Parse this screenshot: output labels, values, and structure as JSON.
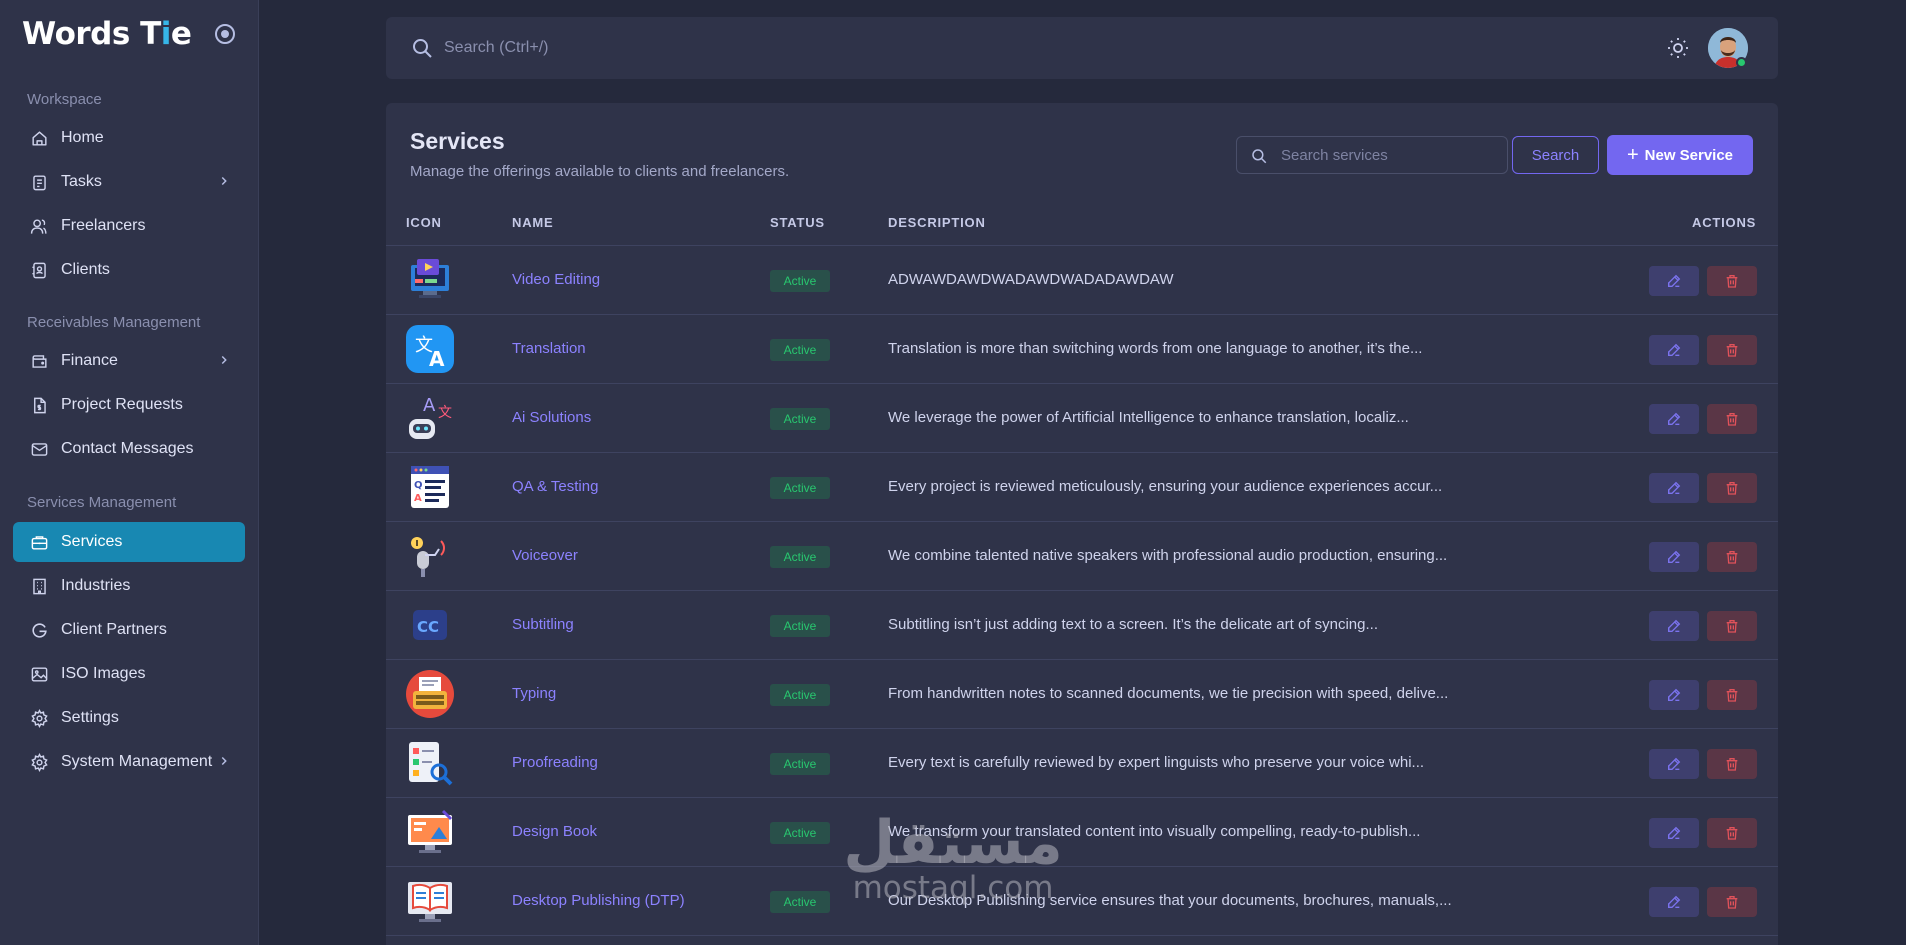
{
  "brand": {
    "name_pre": "Words T",
    "name_accent": "i",
    "name_post": "e"
  },
  "topbar": {
    "search_placeholder": "Search (Ctrl+/)"
  },
  "sidebar": {
    "sections": [
      "Workspace",
      "Receivables Management",
      "Services Management"
    ],
    "items": [
      {
        "label": "Home",
        "icon": "home-icon"
      },
      {
        "label": "Tasks",
        "icon": "clipboard-icon",
        "expandable": true
      },
      {
        "label": "Freelancers",
        "icon": "users-icon"
      },
      {
        "label": "Clients",
        "icon": "address-book-icon"
      },
      {
        "label": "Finance",
        "icon": "wallet-icon",
        "expandable": true
      },
      {
        "label": "Project Requests",
        "icon": "file-dollar-icon"
      },
      {
        "label": "Contact Messages",
        "icon": "mail-icon"
      },
      {
        "label": "Services",
        "icon": "briefcase-icon",
        "active": true
      },
      {
        "label": "Industries",
        "icon": "building-icon"
      },
      {
        "label": "Client Partners",
        "icon": "google-g-icon"
      },
      {
        "label": "ISO Images",
        "icon": "image-icon"
      },
      {
        "label": "Settings",
        "icon": "gear-icon"
      },
      {
        "label": "System Management",
        "icon": "gear-icon",
        "expandable": true
      }
    ]
  },
  "services": {
    "title": "Services",
    "subtitle": "Manage the offerings available to clients and freelancers.",
    "search_placeholder": "Search services",
    "search_button": "Search",
    "new_button": "New Service",
    "columns": [
      "ICON",
      "NAME",
      "STATUS",
      "DESCRIPTION",
      "ACTIONS"
    ],
    "rows": [
      {
        "name": "Video Editing",
        "status": "Active",
        "description": "ADWAWDAWDWADAWDWADADAWDAW",
        "icon": "video-editing-icon"
      },
      {
        "name": "Translation",
        "status": "Active",
        "description": "Translation is more than switching words from one language to another, it’s the...",
        "icon": "translate-icon"
      },
      {
        "name": "Ai Solutions",
        "status": "Active",
        "description": "We leverage the power of Artificial Intelligence to enhance translation, localiz...",
        "icon": "robot-icon"
      },
      {
        "name": "QA & Testing",
        "status": "Active",
        "description": "Every project is reviewed meticulously, ensuring your audience experiences accur...",
        "icon": "qa-document-icon"
      },
      {
        "name": "Voiceover",
        "status": "Active",
        "description": "We combine talented native speakers with professional audio production, ensuring...",
        "icon": "microphone-icon"
      },
      {
        "name": "Subtitling",
        "status": "Active",
        "description": "Subtitling isn’t just adding text to a screen. It’s the delicate art of syncing...",
        "icon": "closed-caption-icon"
      },
      {
        "name": "Typing",
        "status": "Active",
        "description": "From handwritten notes to scanned documents, we tie precision with speed, delive...",
        "icon": "typewriter-icon"
      },
      {
        "name": "Proofreading",
        "status": "Active",
        "description": "Every text is carefully reviewed by expert linguists who preserve your voice whi...",
        "icon": "magnifier-checklist-icon"
      },
      {
        "name": "Design Book",
        "status": "Active",
        "description": "We transform your translated content into visually compelling, ready-to-publish...",
        "icon": "design-monitor-icon"
      },
      {
        "name": "Desktop Publishing (DTP)",
        "status": "Active",
        "description": "Our Desktop Publishing service ensures that your documents, brochures, manuals,...",
        "icon": "book-monitor-icon"
      }
    ]
  },
  "watermark": {
    "arabic": "مستقل",
    "latin": "mostaql.com"
  },
  "colors": {
    "accent": "#7367f0",
    "sidebar_active": "#1888b2",
    "success": "#28c76f",
    "danger": "#ea5455"
  }
}
